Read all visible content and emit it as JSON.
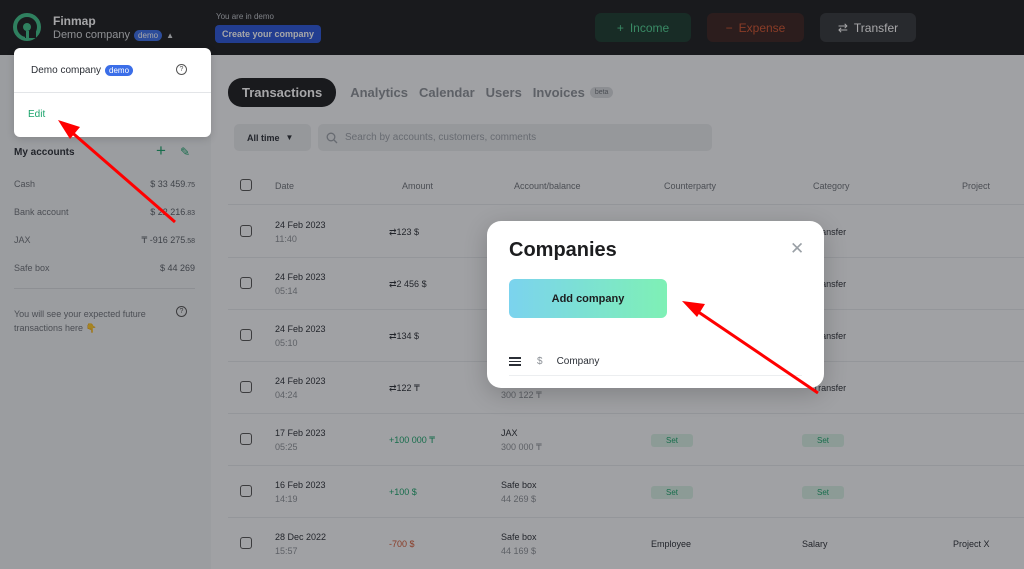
{
  "header": {
    "brand": "Finmap",
    "company": "Demo company",
    "company_badge": "demo",
    "demo_note": "You are in demo",
    "create_company": "Create your company",
    "income": "Income",
    "expense": "Expense",
    "transfer": "Transfer"
  },
  "dropdown": {
    "company": "Demo company",
    "badge": "demo",
    "edit": "Edit"
  },
  "sidebar": {
    "accounts_title": "My accounts",
    "accounts": [
      {
        "name": "Cash",
        "amount": "$ 33 459",
        "cents": ".75"
      },
      {
        "name": "Bank account",
        "amount": "$ 22 216",
        "cents": ".83"
      },
      {
        "name": "JAX",
        "amount": "₸ -916 275",
        "cents": ".58"
      },
      {
        "name": "Safe box",
        "amount": "$ 44 269",
        "cents": ""
      }
    ],
    "future_note": "You will see your expected future transactions here 👇"
  },
  "tabs": [
    {
      "label": "Transactions",
      "active": true
    },
    {
      "label": "Analytics"
    },
    {
      "label": "Calendar"
    },
    {
      "label": "Users"
    },
    {
      "label": "Invoices",
      "badge": "beta"
    }
  ],
  "filters": {
    "time": "All time",
    "search_placeholder": "Search by accounts, customers, comments"
  },
  "table": {
    "headers": [
      "Date",
      "Amount",
      "Account/balance",
      "Counterparty",
      "Category",
      "Project"
    ],
    "rows": [
      {
        "date": "24 Feb 2023",
        "time": "11:40",
        "amount": "⇄123 $",
        "type": "transfer",
        "category": "Transfer"
      },
      {
        "date": "24 Feb 2023",
        "time": "05:14",
        "amount": "⇄2 456 $",
        "type": "transfer",
        "category": "Transfer"
      },
      {
        "date": "24 Feb 2023",
        "time": "05:10",
        "amount": "⇄134 $",
        "type": "transfer",
        "category": "Transfer"
      },
      {
        "date": "24 Feb 2023",
        "time": "04:24",
        "amount": "⇄122 ₸",
        "type": "transfer",
        "balance": "300 122 ₸",
        "category": "Transfer"
      },
      {
        "date": "17 Feb 2023",
        "time": "05:25",
        "amount": "+100 000 ₸",
        "type": "income",
        "account": "JAX",
        "balance": "300 000 ₸",
        "counterparty": "Set",
        "category": "Set"
      },
      {
        "date": "16 Feb 2023",
        "time": "14:19",
        "amount": "+100 $",
        "type": "income",
        "account": "Safe box",
        "balance": "44 269 $",
        "counterparty": "Set",
        "category": "Set"
      },
      {
        "date": "28 Dec 2022",
        "time": "15:57",
        "amount": "-700 $",
        "type": "expense",
        "account": "Safe box",
        "balance": "44 169 $",
        "counterparty": "Employee",
        "category": "Salary",
        "project": "Project X"
      }
    ]
  },
  "modal": {
    "title": "Companies",
    "add_button": "Add company",
    "companies": [
      {
        "currency": "$",
        "name": "Company"
      }
    ]
  },
  "colors": {
    "accent_green": "#1aa36b",
    "expense_red": "#d0542f",
    "annotation_arrow": "#ff0000"
  }
}
